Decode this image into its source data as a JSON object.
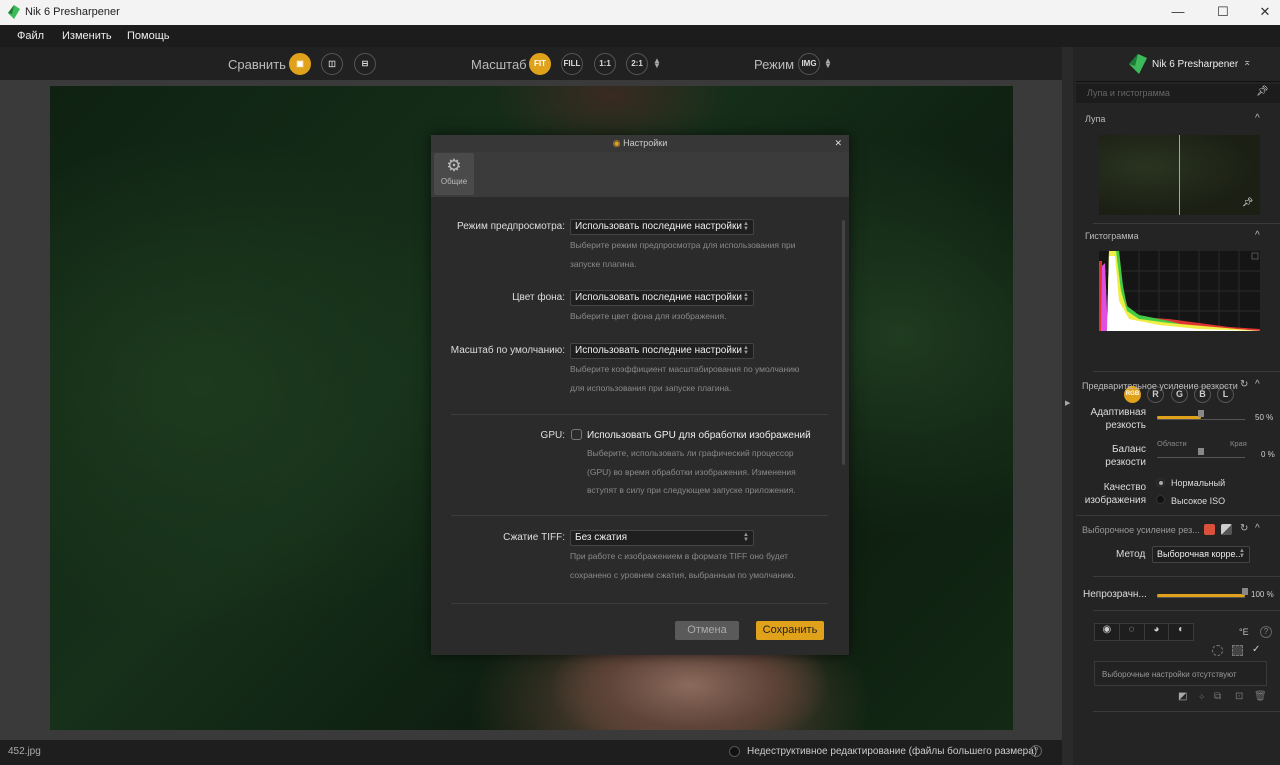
{
  "window": {
    "title": "Nik 6 Presharpener",
    "minimize": "—",
    "maximize": "☐",
    "close": "✕"
  },
  "menu": [
    "Файл",
    "Изменить",
    "Помощь"
  ],
  "toolbar": {
    "compare_label": "Сравнить",
    "zoom_label": "Масштаб",
    "zoom_options": [
      "FIT",
      "FILL",
      "1:1",
      "2:1"
    ],
    "zoom_selected": "FIT",
    "mode_label": "Режим",
    "mode_value": "IMG"
  },
  "status": {
    "filename": "452.jpg",
    "nondestructive_label": "Недеструктивное редактирование (файлы большего размера)",
    "help": "?"
  },
  "panel": {
    "title": "Nik 6 Presharpener",
    "loupe_hist_header": "Лупа и гистограмма",
    "loupe_label": "Лупа",
    "histogram_label": "Гистограмма",
    "channels": [
      "RGB",
      "R",
      "G",
      "B",
      "L"
    ],
    "channel_selected": "RGB",
    "presharpen_header": "Предварительное усиление резкости",
    "adaptive_label": [
      "Адаптивная",
      "резкость"
    ],
    "adaptive_value": "50 %",
    "adaptive_fraction": 0.5,
    "balance_label": [
      "Баланс",
      "резкости"
    ],
    "balance_left": "Области",
    "balance_right": "Края",
    "balance_value": "0 %",
    "quality_label": [
      "Качество",
      "изображения"
    ],
    "quality_options": [
      "Нормальный",
      "Высокое ISO"
    ],
    "quality_selected": "Нормальный",
    "selective_header": "Выборочное усиление рез...",
    "method_label": "Метод",
    "method_value": "Выборочная корре...",
    "opacity_label": "Непрозрачн...",
    "opacity_value": "100 %",
    "opacity_fraction": 1.0,
    "no_selective": "Выборочные настройки отсутствуют",
    "help": "?"
  },
  "dialog": {
    "title": "Настройки",
    "close": "✕",
    "tab_general": "Общие",
    "preview_mode_label": "Режим предпросмотра:",
    "preview_mode_value": "Использовать последние настройки",
    "preview_mode_desc": [
      "Выберите режим предпросмотра для использования при",
      "запуске плагина."
    ],
    "bg_color_label": "Цвет фона:",
    "bg_color_value": "Использовать последние настройки",
    "bg_color_desc": "Выберите цвет фона для изображения.",
    "default_zoom_label": "Масштаб по умолчанию:",
    "default_zoom_value": "Использовать последние настройки",
    "default_zoom_desc": [
      "Выберите коэффициент масштабирования по умолчанию",
      "для использования при запуске плагина."
    ],
    "gpu_label": "GPU:",
    "gpu_checkbox": "Использовать GPU для обработки изображений",
    "gpu_checked": false,
    "gpu_desc": [
      "Выберите, использовать ли графический процессор",
      "(GPU) во время обработки изображения. Изменения",
      "вступят в силу при следующем запуске приложения."
    ],
    "tiff_label": "Сжатие TIFF:",
    "tiff_value": "Без сжатия",
    "tiff_desc": [
      "При работе с изображением в формате TIFF оно будет",
      "сохранено с уровнем сжатия, выбранным по умолчанию."
    ],
    "cancel": "Отмена",
    "save": "Сохранить"
  },
  "colors": {
    "accent": "#e0a11b",
    "brand_green": "#3dba5a"
  }
}
